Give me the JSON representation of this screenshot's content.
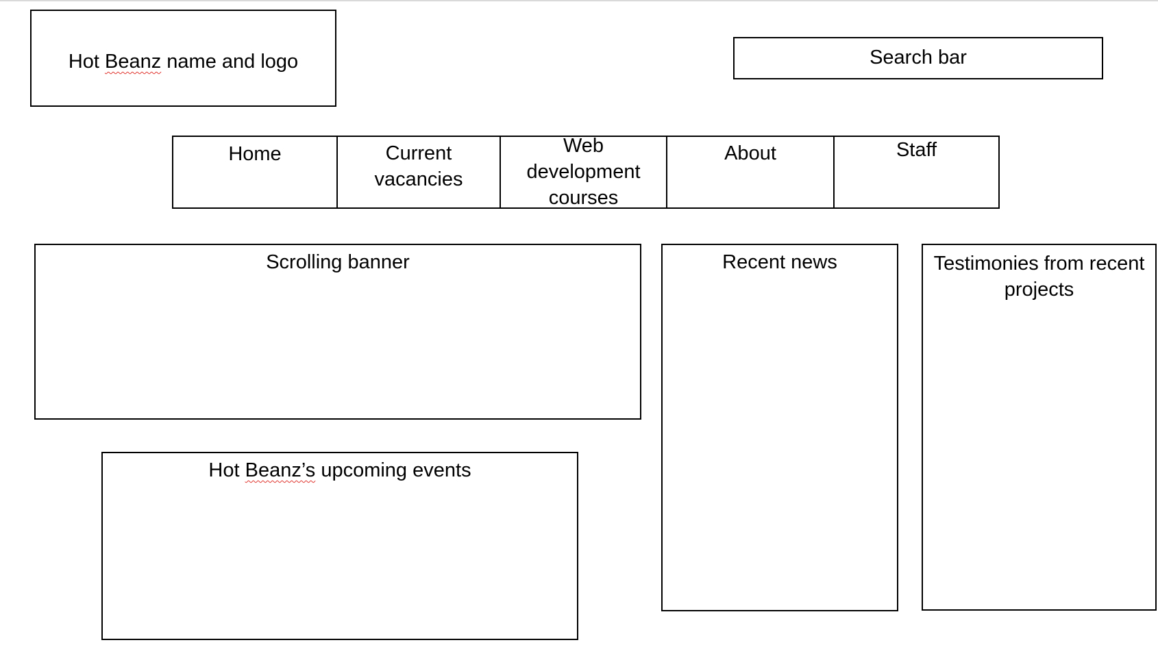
{
  "header": {
    "logo_label_pre": "Hot ",
    "logo_label_brand": "Beanz",
    "logo_label_post": " name and logo",
    "search_label": "Search bar"
  },
  "nav": {
    "items": [
      {
        "label": "Home"
      },
      {
        "label": "Current vacancies"
      },
      {
        "label": "Web development courses"
      },
      {
        "label": "About"
      },
      {
        "label": "Staff"
      }
    ]
  },
  "main": {
    "banner_label": "Scrolling banner",
    "news_label": "Recent news",
    "testimonies_label": "Testimonies from recent projects",
    "events_label_pre": "Hot ",
    "events_label_brand": "Beanz’s",
    "events_label_post": " upcoming events"
  }
}
